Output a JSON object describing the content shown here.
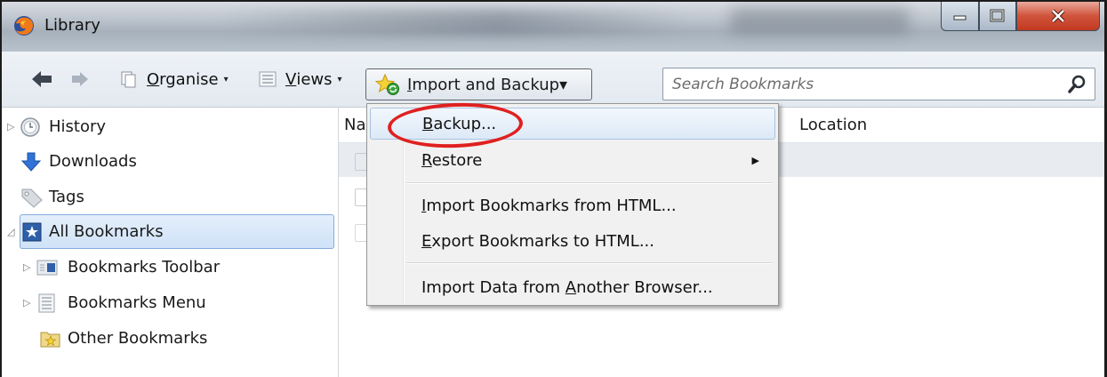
{
  "window": {
    "title": "Library"
  },
  "toolbar": {
    "organise": {
      "access_key": "O",
      "rest": "rganise"
    },
    "views": {
      "access_key": "V",
      "rest": "iews"
    },
    "import_backup": {
      "access_key": "I",
      "rest": "mport and Backup"
    },
    "search": {
      "placeholder": "Search Bookmarks",
      "value": ""
    }
  },
  "sidebar": {
    "items": [
      {
        "label": "History"
      },
      {
        "label": "Downloads"
      },
      {
        "label": "Tags"
      },
      {
        "label": "All Bookmarks"
      },
      {
        "label": "Bookmarks Toolbar"
      },
      {
        "label": "Bookmarks Menu"
      },
      {
        "label": "Other Bookmarks"
      }
    ]
  },
  "content": {
    "columns": {
      "name_partial": "Na",
      "location": "Location"
    }
  },
  "menu": {
    "items": [
      {
        "key": "B",
        "rest": "ackup..."
      },
      {
        "key": "R",
        "rest": "estore"
      },
      {
        "key": "I",
        "rest": "mport Bookmarks from HTML..."
      },
      {
        "key": "E",
        "rest": "xport Bookmarks to HTML..."
      },
      {
        "before": "Import Data from ",
        "key": "A",
        "rest": "nother Browser..."
      }
    ]
  },
  "colors": {
    "annotation": "#e02020",
    "selection": "#cfe2f8",
    "close_button": "#c94b30"
  }
}
